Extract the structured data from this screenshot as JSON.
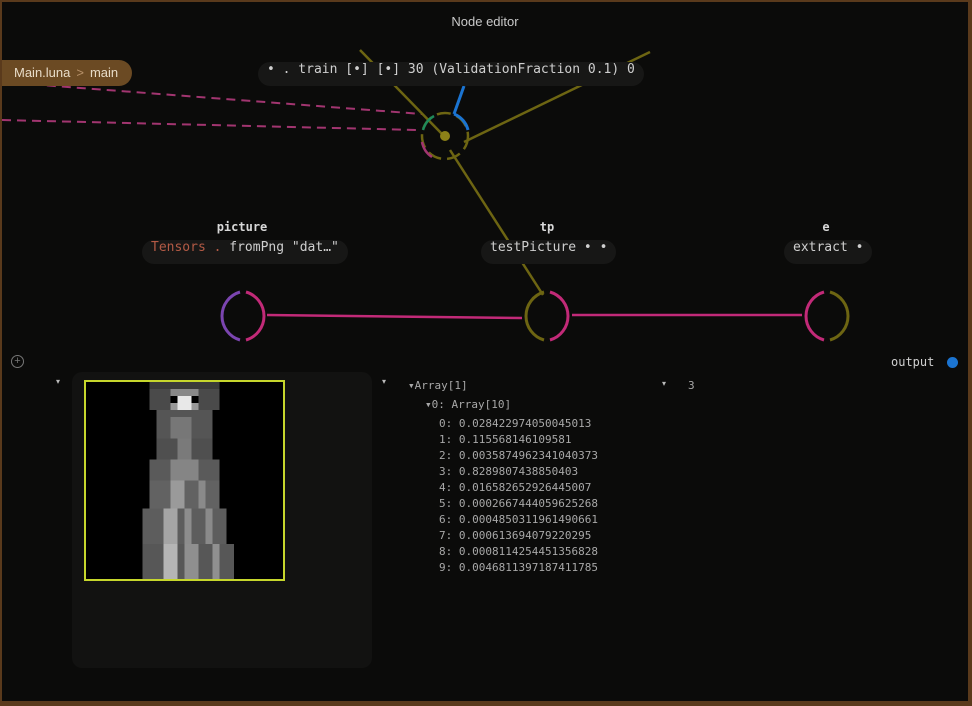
{
  "window": {
    "title": "Node editor"
  },
  "breadcrumb": {
    "file": "Main.luna",
    "separator": ">",
    "function": "main"
  },
  "nodes": {
    "train": {
      "dot": "•",
      "text": ". train [•] [•] 30 (ValidationFraction 0.1) 0"
    },
    "picture": {
      "label": "picture",
      "expr_class": "Tensors",
      "expr_dot": ".",
      "expr_call": "fromPng",
      "expr_arg": "\"dat…\""
    },
    "tp": {
      "label": "tp",
      "expr": "testPicture • •"
    },
    "e": {
      "label": "e",
      "expr": "extract •"
    }
  },
  "output": {
    "label": "output",
    "add_icon": "+"
  },
  "preview": {
    "toggle_left": "▾",
    "toggle_right": "▾"
  },
  "result": {
    "root": "Array[1]",
    "root_count": "3",
    "child": "0: Array[10]",
    "items": [
      "0: 0.028422974050045013",
      "1: 0.115568146109581",
      "2: 0.0035874962341040373",
      "3: 0.8289807438850403",
      "4: 0.016582652926445007",
      "5: 0.0002667444059625268",
      "6: 0.0004850311961490661",
      "7: 0.000613694079220295",
      "8: 0.0008114254451356828",
      "9: 0.0046811397187411785"
    ]
  },
  "colors": {
    "accent_yellow": "#c6d62c",
    "port_magenta": "#c22a78",
    "port_olive": "#6d6512",
    "port_blue": "#1b74d1",
    "port_purple": "#7b45b0",
    "breadcrumb": "#6b4a23"
  }
}
